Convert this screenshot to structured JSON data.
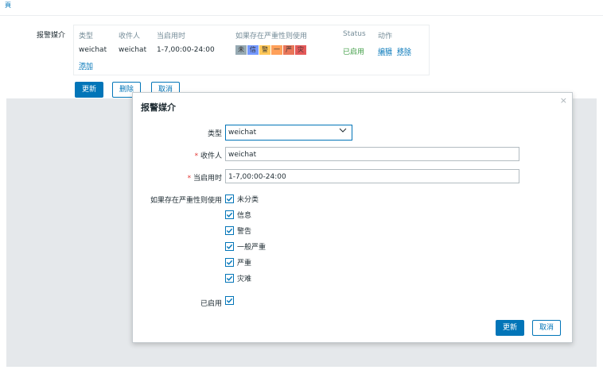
{
  "top": {
    "link": "頁"
  },
  "media_section": {
    "label": "报警媒介",
    "table": {
      "headers": [
        "类型",
        "收件人",
        "当启用时",
        "如果存在严重性则使用",
        "Status",
        "动作"
      ],
      "row": {
        "type": "weichat",
        "recipient": "weichat",
        "when_active": "1-7,00:00-24:00",
        "severity_badges": [
          {
            "label": "未",
            "color": "#97aab3"
          },
          {
            "label": "信",
            "color": "#7499ff"
          },
          {
            "label": "警",
            "color": "#ffc859"
          },
          {
            "label": "一",
            "color": "#ffa059"
          },
          {
            "label": "严",
            "color": "#e97659"
          },
          {
            "label": "灾",
            "color": "#e45959"
          }
        ],
        "status": "已启用",
        "edit": "编辑",
        "remove": "移除"
      },
      "add_link": "添加"
    },
    "buttons": {
      "update": "更新",
      "delete": "删除",
      "cancel": "取消"
    }
  },
  "dialog": {
    "title": "报警媒介",
    "close": "×",
    "type_label": "类型",
    "type_value": "weichat",
    "recipient_label": "收件人",
    "recipient_value": "weichat",
    "when_label": "当启用时",
    "when_value": "1-7,00:00-24:00",
    "severity_label": "如果存在严重性则使用",
    "severities": [
      "未分类",
      "信息",
      "警告",
      "一般严重",
      "严重",
      "灾难"
    ],
    "enabled_label": "已启用",
    "update_button": "更新",
    "cancel_button": "取消"
  },
  "colors": {
    "accent": "#0275b8",
    "enabled": "#429e47"
  }
}
